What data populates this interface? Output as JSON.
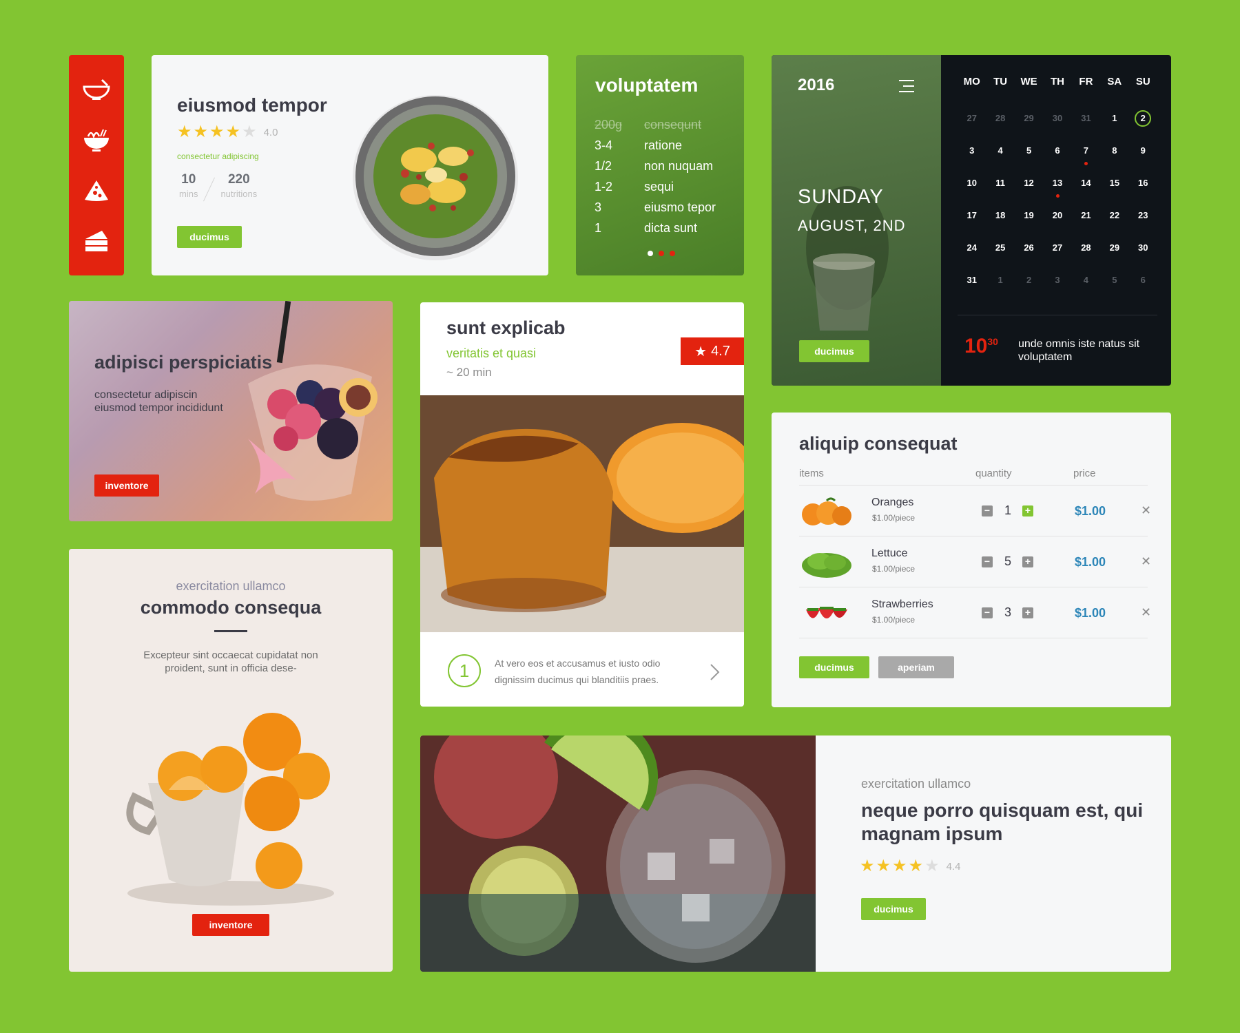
{
  "colors": {
    "background": "#82c532",
    "accent_green": "#82c532",
    "accent_red": "#e3230f",
    "price_blue": "#2d86b8",
    "star": "#f5c223"
  },
  "sidenav": {
    "items": [
      {
        "icon": "bowl-icon"
      },
      {
        "icon": "noodle-bowl-icon"
      },
      {
        "icon": "pizza-slice-icon"
      },
      {
        "icon": "cake-slice-icon"
      }
    ]
  },
  "recipe": {
    "title": "eiusmod tempor",
    "rating": 4.0,
    "rating_label": "4.0",
    "subtitle": "consectetur adipiscing",
    "stat1_value": "10",
    "stat1_label": "mins",
    "stat2_value": "220",
    "stat2_label": "nutritions",
    "button": "ducimus"
  },
  "ingredients": {
    "title": "voluptatem",
    "rows": [
      {
        "qty": "200g",
        "name": "consequnt"
      },
      {
        "qty": "3-4",
        "name": "ratione"
      },
      {
        "qty": "1/2",
        "name": "non nuquam"
      },
      {
        "qty": "1-2",
        "name": "sequi"
      },
      {
        "qty": "3",
        "name": "eiusmo tepor"
      },
      {
        "qty": "1",
        "name": "dicta sunt"
      }
    ],
    "active_dot": 0,
    "dot_count": 3
  },
  "calendar": {
    "year": "2016",
    "day_name": "SUNDAY",
    "date_name": "AUGUST, 2ND",
    "button": "ducimus",
    "weekdays": [
      "MO",
      "TU",
      "WE",
      "TH",
      "FR",
      "SA",
      "SU"
    ],
    "weeks": [
      [
        "27",
        "28",
        "29",
        "30",
        "31",
        "1",
        "2"
      ],
      [
        "3",
        "4",
        "5",
        "6",
        "7",
        "8",
        "9"
      ],
      [
        "10",
        "11",
        "12",
        "13",
        "14",
        "15",
        "16"
      ],
      [
        "17",
        "18",
        "19",
        "20",
        "21",
        "22",
        "23"
      ],
      [
        "24",
        "25",
        "26",
        "27",
        "28",
        "29",
        "30"
      ],
      [
        "31",
        "1",
        "2",
        "3",
        "4",
        "5",
        "6"
      ]
    ],
    "event_hour": "10",
    "event_minute": "30",
    "event_text": "unde omnis iste natus sit voluptatem"
  },
  "promo": {
    "title": "adipisci perspiciatis",
    "description": "consectetur adipiscin eiusmod tempor incididunt",
    "button": "inventore"
  },
  "dish": {
    "title": "sunt explicab",
    "subtitle": "veritatis et quasi",
    "time": "~ 20 min",
    "rating_label": "4.7",
    "step_number": "1",
    "step_text": "At vero eos et accusamus et iusto odio dignissim ducimus qui blanditiis praes."
  },
  "cart": {
    "title": "aliquip consequat",
    "col_items": "items",
    "col_quantity": "quantity",
    "col_price": "price",
    "rows": [
      {
        "name": "Oranges",
        "unit": "$1.00/piece",
        "qty": "1",
        "price": "$1.00",
        "thumb": "oranges"
      },
      {
        "name": "Lettuce",
        "unit": "$1.00/piece",
        "qty": "5",
        "price": "$1.00",
        "thumb": "lettuce"
      },
      {
        "name": "Strawberries",
        "unit": "$1.00/piece",
        "qty": "3",
        "price": "$1.00",
        "thumb": "strawberries"
      }
    ],
    "button_primary": "ducimus",
    "button_secondary": "aperiam"
  },
  "feature": {
    "kicker": "exercitation ullamco",
    "title": "commodo consequa",
    "description": "Excepteur sint occaecat cupidatat non proident, sunt in officia dese-",
    "button": "inventore"
  },
  "banner": {
    "kicker": "exercitation ullamco",
    "title": "neque porro quisquam est, qui magnam ipsum",
    "rating": 4.4,
    "rating_label": "4.4",
    "button": "ducimus"
  }
}
